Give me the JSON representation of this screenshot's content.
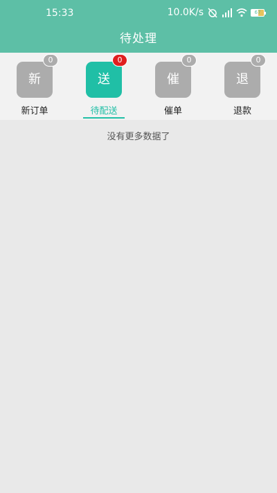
{
  "status_bar": {
    "time": "15:33",
    "net_speed": "10.0K/s",
    "battery": "67"
  },
  "header": {
    "title": "待处理"
  },
  "tabs": [
    {
      "icon_char": "新",
      "label": "新订单",
      "badge": "0",
      "active": false
    },
    {
      "icon_char": "送",
      "label": "待配送",
      "badge": "0",
      "active": true
    },
    {
      "icon_char": "催",
      "label": "催单",
      "badge": "0",
      "active": false
    },
    {
      "icon_char": "退",
      "label": "退款",
      "badge": "0",
      "active": false
    }
  ],
  "content": {
    "empty_message": "没有更多数据了"
  },
  "colors": {
    "header_bg": "#5dbfa6",
    "accent": "#20bfa6",
    "badge_active": "#e01f1f",
    "inactive": "#acacac"
  }
}
